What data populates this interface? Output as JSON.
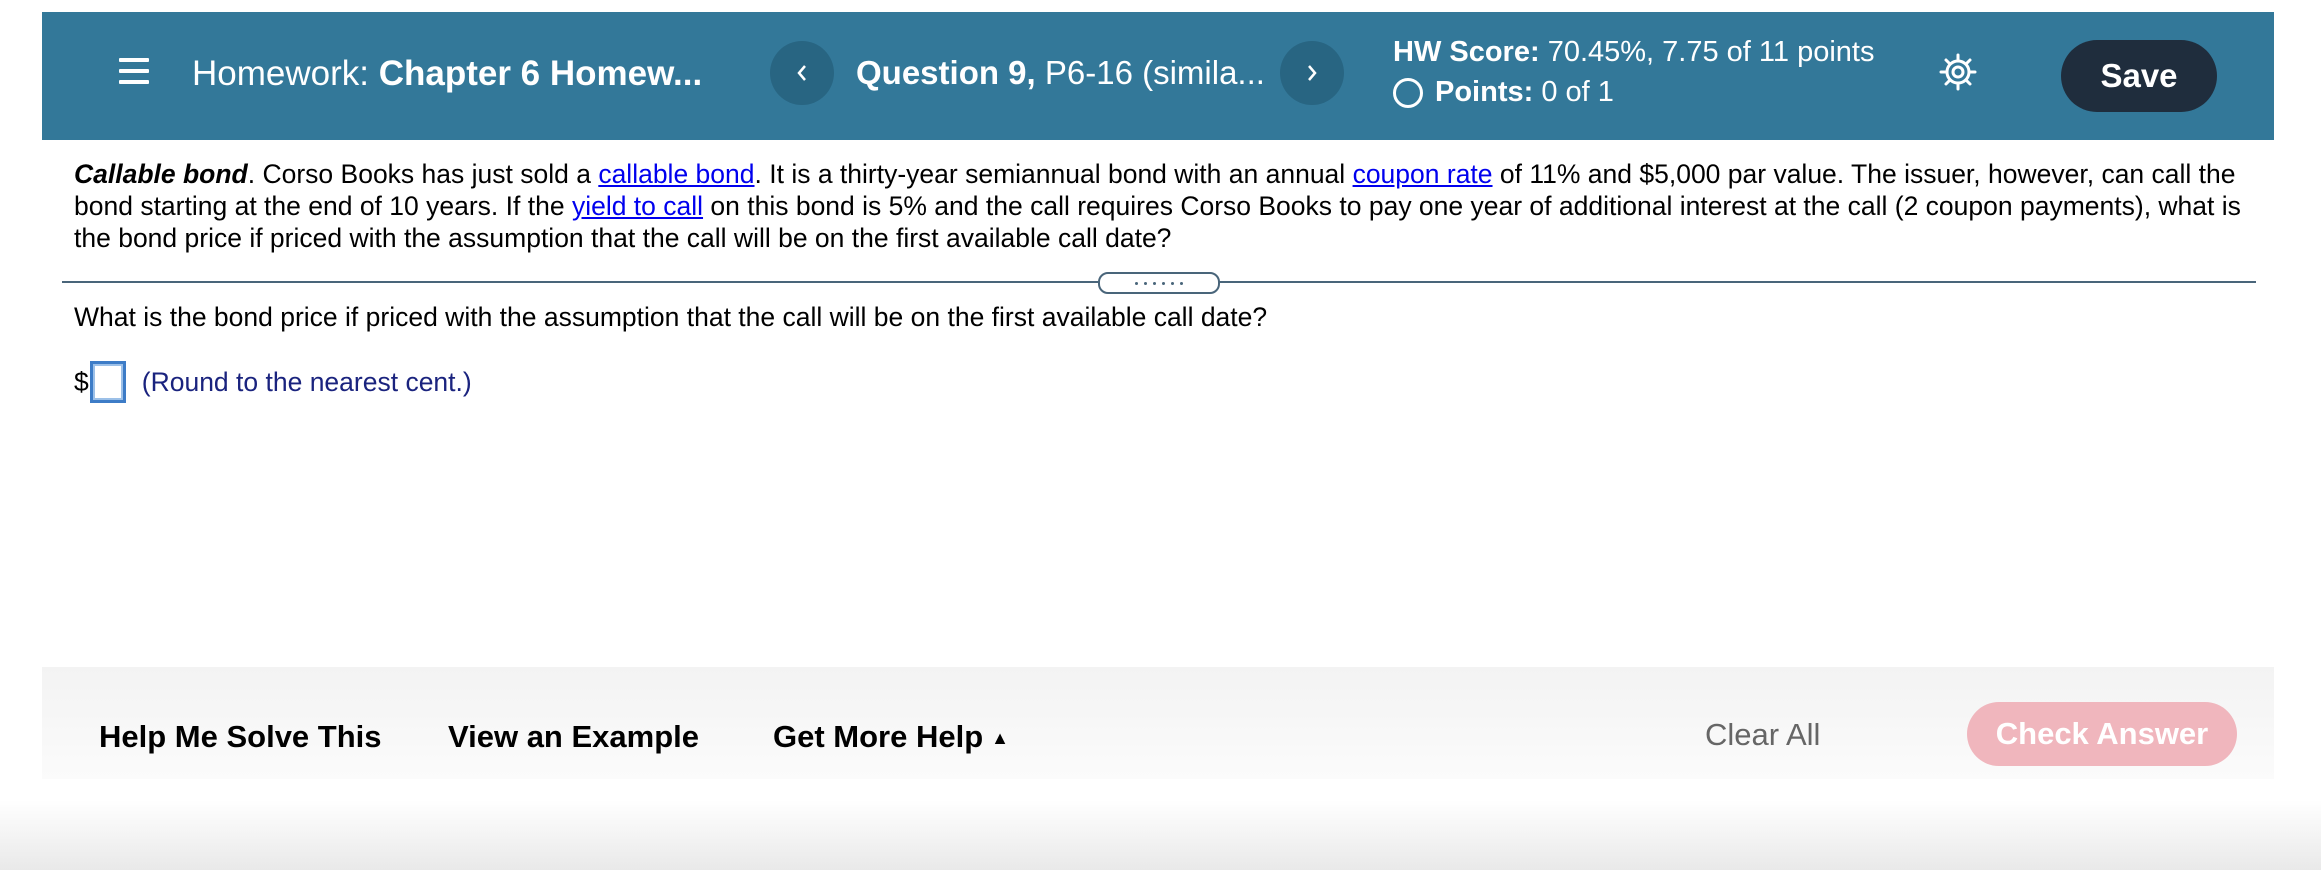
{
  "header": {
    "hw_label": "Homework:",
    "hw_name": "Chapter 6 Homew...",
    "question_label": "Question 9,",
    "question_name": "P6-16 (simila...",
    "score_label": "HW Score:",
    "score_value": "70.45%, 7.75 of 11 points",
    "points_label": "Points:",
    "points_value": "0 of 1",
    "save_label": "Save",
    "icons": {
      "menu": "hamburger-menu-icon",
      "prev": "chevron-left-icon",
      "next": "chevron-right-icon",
      "settings": "gear-icon",
      "points": "empty-circle-icon"
    }
  },
  "problem": {
    "lead": "Callable bond",
    "t1": ". Corso Books has just sold a ",
    "link1": "callable bond",
    "t2": ". It is a thirty-year semiannual bond with an annual ",
    "link2": "coupon rate",
    "t3": " of 11% and $5,000 par value. The issuer, however, can call the bond starting at the end of 10 years. If the ",
    "link3": "yield to call",
    "t4": " on this bond is 5% and the call requires Corso Books to pay one year of additional interest at the call (2 coupon payments), what is the bond price if priced with the assumption that the call will be on the first available call date?"
  },
  "question": {
    "text": "What is the bond price if priced with the assumption that the call will be on the first available call date?",
    "currency": "$",
    "answer_value": "",
    "note": "(Round to the nearest cent.)"
  },
  "footer": {
    "help_solve": "Help Me Solve This",
    "view_example": "View an Example",
    "more_help": "Get More Help",
    "more_help_caret": "▲",
    "clear_all": "Clear All",
    "check_answer": "Check Answer"
  },
  "colors": {
    "header_bg": "#337899",
    "nav_button_bg": "#286582",
    "save_button_bg": "#1f2d3d",
    "link": "#0000ee",
    "note": "#1a237e",
    "check_button_disabled": "#f0b6bd"
  }
}
